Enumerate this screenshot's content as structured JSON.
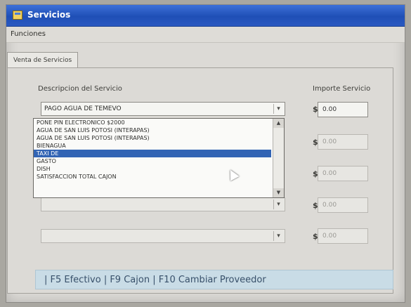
{
  "window": {
    "title": "Servicios"
  },
  "menu": {
    "item": "Funciones"
  },
  "tab": {
    "label": "Venta de Servicios"
  },
  "labels": {
    "description": "Descripcion del Servicio",
    "amount": "Importe Servicio"
  },
  "service_combo": {
    "value": "PAGO AGUA DE TEMEVO"
  },
  "dropdown": {
    "items": [
      "PONE PIN ELECTRONICO $2000",
      "AGUA DE SAN LUIS POTOSI (INTERAPAS)",
      "AGUA DE SAN LUIS POTOSI (INTERAPAS)",
      "BIENAGUA",
      "TAXI DE",
      "GASTO",
      "DISH",
      "SATISFACCION TOTAL CAJON"
    ],
    "selected_index": 4
  },
  "currency_symbol": "$",
  "amounts": [
    "0.00",
    "0.00",
    "0.00",
    "0.00",
    "0.00"
  ],
  "status_bar": {
    "text": "| F5 Efectivo   | F9 Cajon   | F10 Cambiar Proveedor"
  },
  "colors": {
    "titlebar": "#2a59c1",
    "selection": "#3264b4",
    "status_bg": "#c9dce6"
  }
}
